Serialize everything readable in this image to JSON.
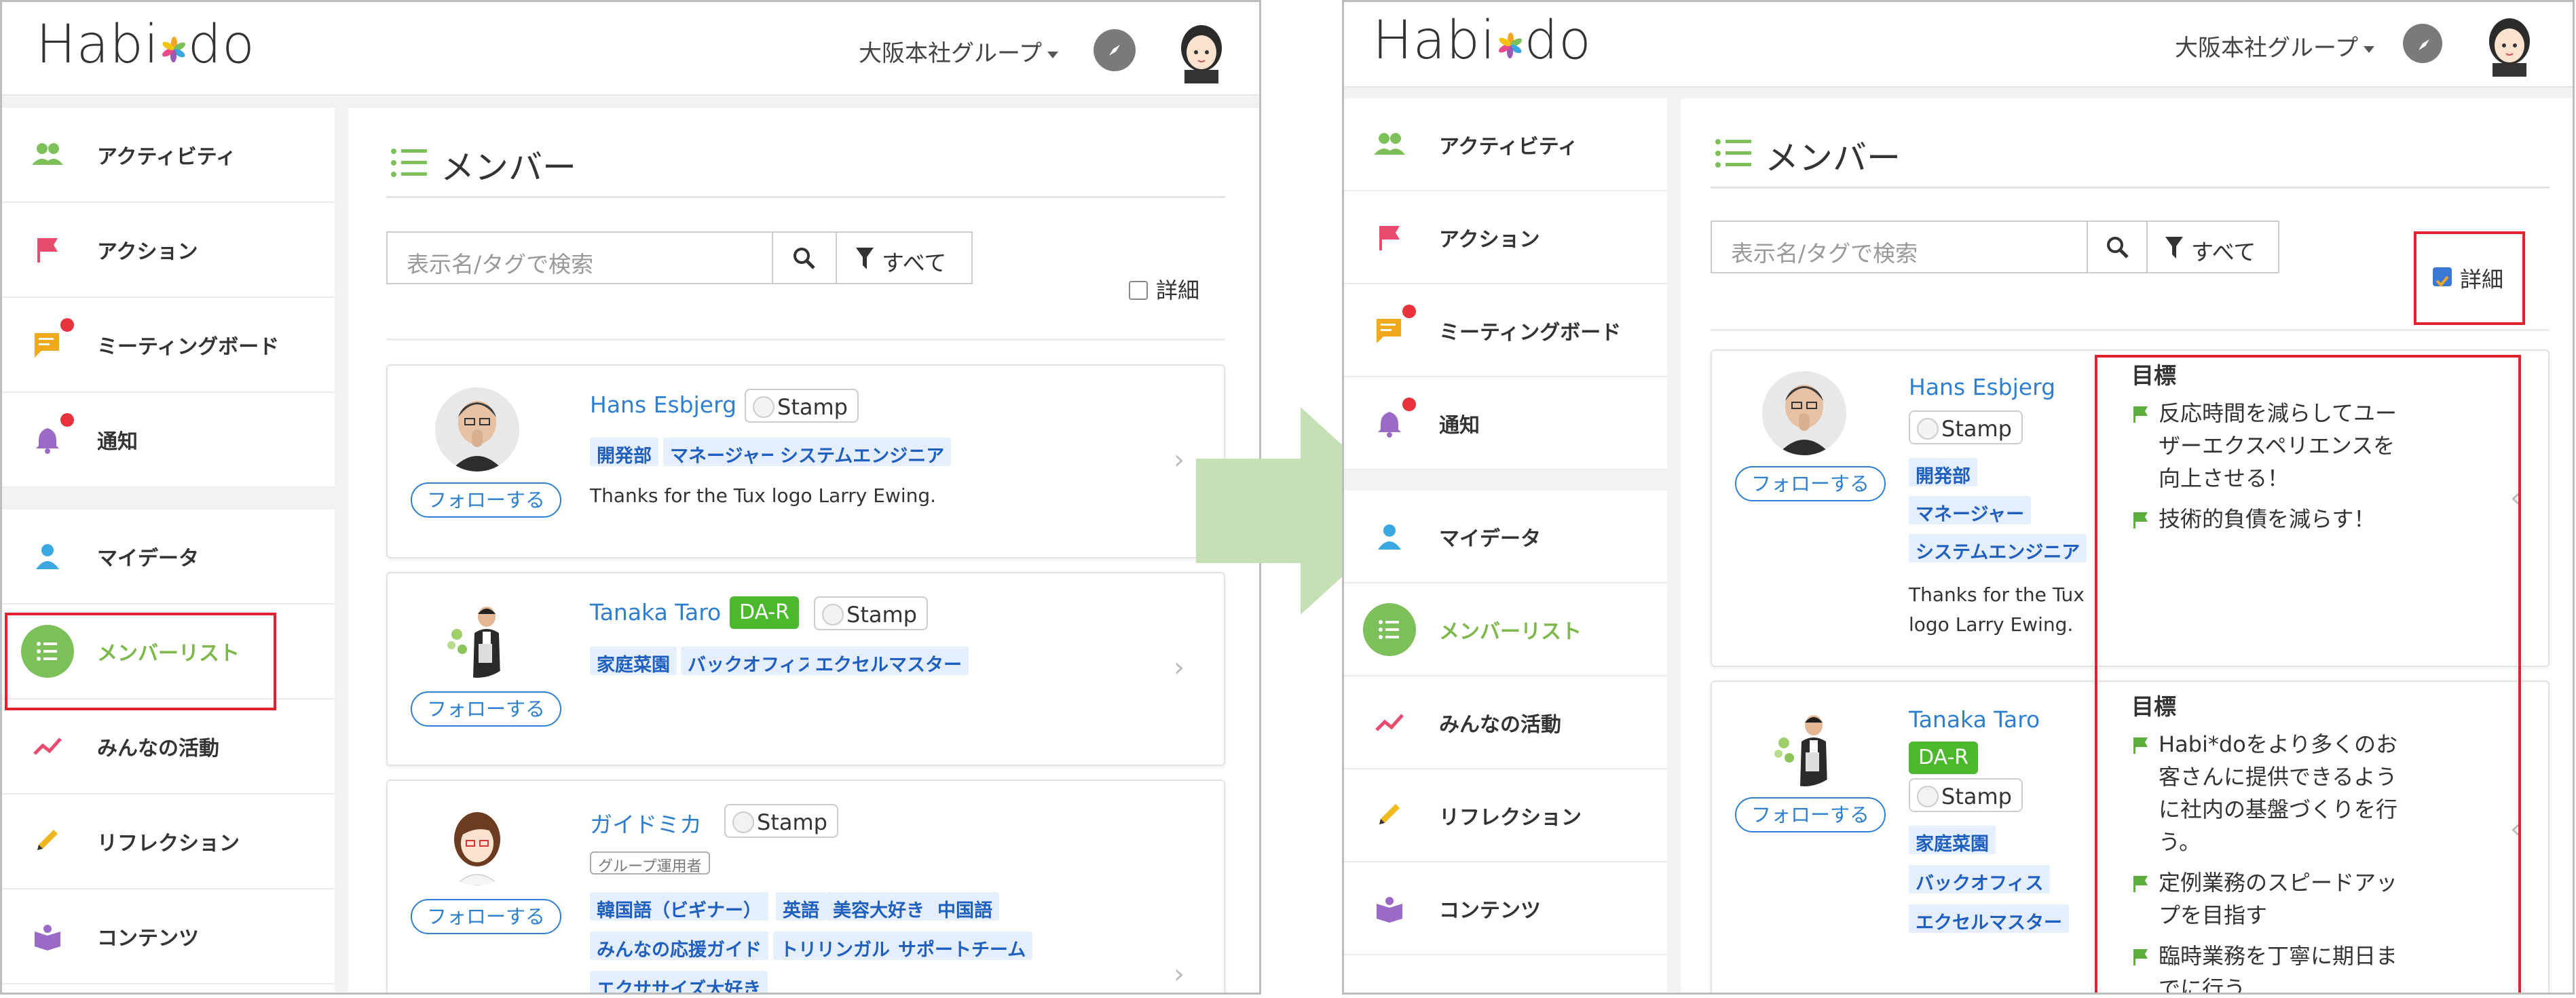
{
  "app": {
    "logo_left": "Habi",
    "logo_right": "do"
  },
  "header": {
    "group": "大阪本社グループ",
    "colors": {
      "accent": "#7cb84a",
      "link": "#2e7fd0",
      "highlight": "#e0242f"
    }
  },
  "nav": [
    {
      "label": "アクティビティ",
      "icon": "people-icon"
    },
    {
      "label": "アクション",
      "icon": "flag-icon"
    },
    {
      "label": "ミーティングボード",
      "icon": "chat-icon"
    },
    {
      "label": "通知",
      "icon": "bell-icon"
    },
    {
      "label": "マイデータ",
      "icon": "person-icon"
    },
    {
      "label": "メンバーリスト",
      "icon": "list-icon"
    },
    {
      "label": "みんなの活動",
      "icon": "trend-icon"
    },
    {
      "label": "リフレクション",
      "icon": "pencil-icon"
    },
    {
      "label": "コンテンツ",
      "icon": "book-icon"
    }
  ],
  "page": {
    "title": "メンバー",
    "search_placeholder": "表示名/タグで検索",
    "filter_label": "すべて",
    "detail_label": "詳細",
    "follow_label": "フォローする",
    "stamp_label": "Stamp",
    "goal_heading": "目標"
  },
  "members": [
    {
      "name": "Hans Esbjerg",
      "tags": [
        "開発部",
        "マネージャー",
        "システムエンジニア"
      ],
      "message": "Thanks for the Tux logo Larry Ewing.",
      "message_wrapped": [
        "Thanks for the Tux",
        "logo Larry Ewing."
      ],
      "goals": [
        [
          "反応時間を減らしてユー",
          "ザーエクスペリエンスを",
          "向上させる！"
        ],
        [
          "技術的負債を減らす！"
        ]
      ]
    },
    {
      "name": "Tanaka Taro",
      "badge": "DA-R",
      "tags": [
        "家庭菜園",
        "バックオフィス",
        "エクセルマスター"
      ],
      "goals": [
        [
          "Habi*doをより多くのお",
          "客さんに提供できるよう",
          "に社内の基盤づくりを行",
          "う。"
        ],
        [
          "定例業務のスピードアッ",
          "プを目指す"
        ],
        [
          "臨時業務を丁寧に期日ま",
          "でに行う"
        ]
      ]
    },
    {
      "name": "ガイドミカ",
      "role": "グループ運用者",
      "tags_row1": [
        "韓国語（ビギナー）",
        "英語",
        "美容大好き",
        "中国語"
      ],
      "tags_row2": [
        "みんなの応援ガイド",
        "トリリンガル",
        "サポートチーム"
      ],
      "tags_row3": [
        "エクササイズ大好き"
      ]
    }
  ]
}
